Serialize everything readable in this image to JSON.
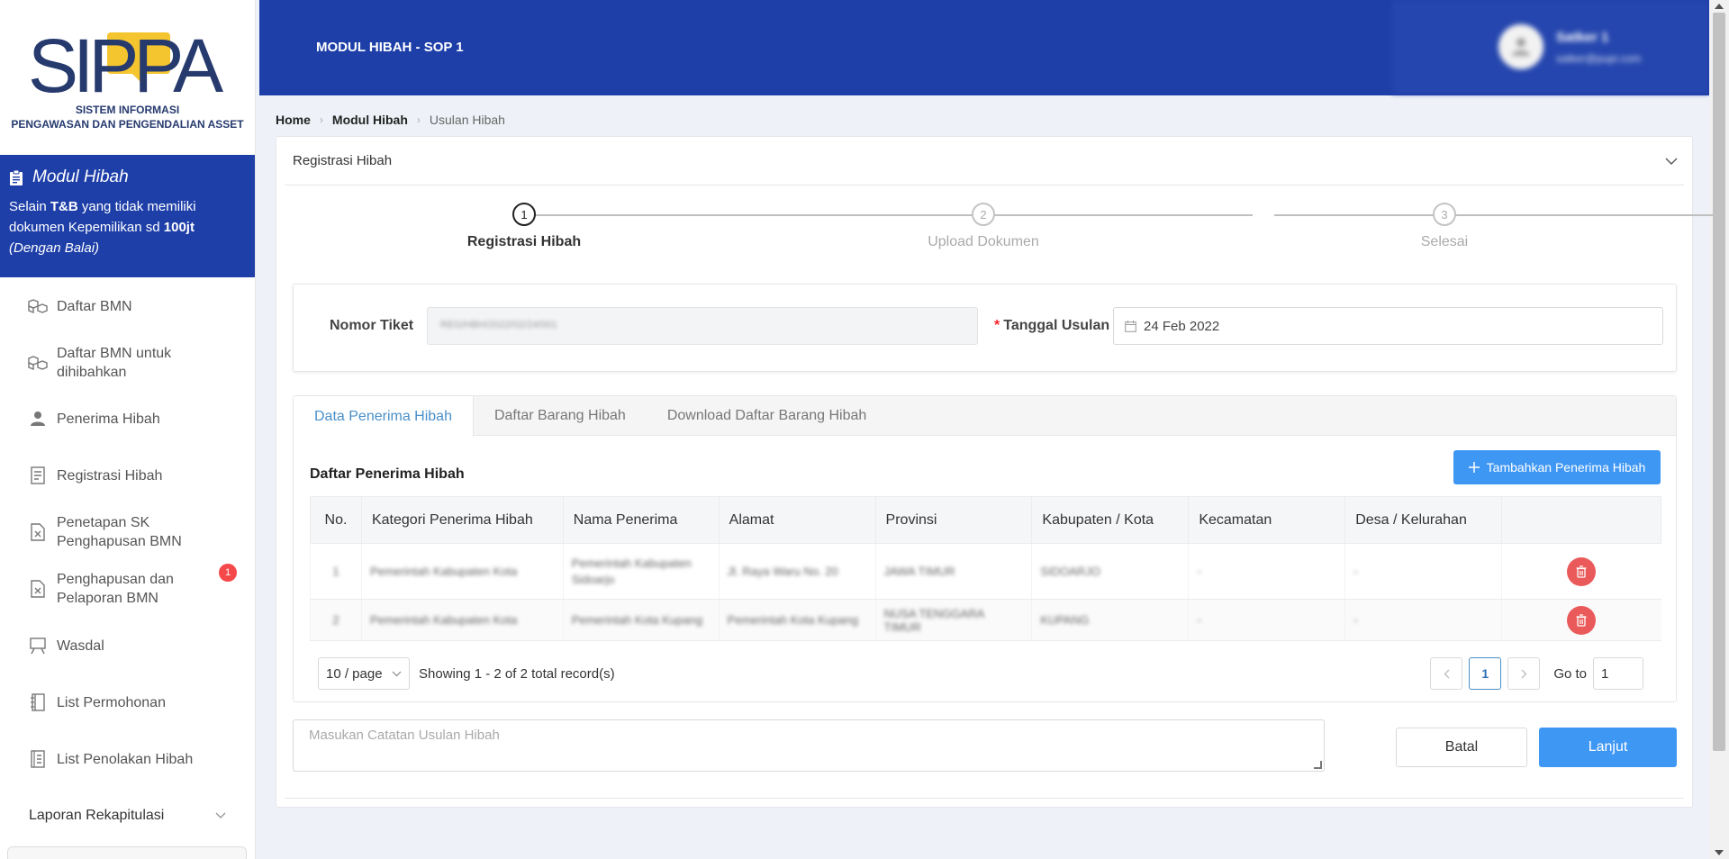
{
  "brand": {
    "logo_text": "SIPPA",
    "subtitle_line1": "SISTEM INFORMASI",
    "subtitle_line2": "PENGAWASAN DAN PENGENDALIAN ASSET",
    "colors": {
      "navy": "#263a6e",
      "gold": "#f4c52f"
    }
  },
  "module": {
    "title": "Modul Hibah",
    "desc_pre": "Selain ",
    "desc_bold1": "T&B",
    "desc_mid": " yang tidak memiliki dokumen Kepemilikan sd ",
    "desc_bold2": "100jt",
    "desc_italic": "(Dengan Balai)"
  },
  "sidebar": {
    "items": [
      {
        "label": "Daftar BMN",
        "icon": "boxes-icon"
      },
      {
        "label": "Daftar BMN untuk dihibahkan",
        "icon": "boxes-icon"
      },
      {
        "label": "Penerima Hibah",
        "icon": "user-icon"
      },
      {
        "label": "Registrasi Hibah",
        "icon": "document-icon"
      },
      {
        "label": "Penetapan SK Penghapusan BMN",
        "icon": "file-x-icon"
      },
      {
        "label": "Penghapusan dan Pelaporan BMN",
        "icon": "file-x-icon",
        "badge": "1"
      },
      {
        "label": "Wasdal",
        "icon": "board-icon"
      },
      {
        "label": "List Permohonan",
        "icon": "notebook-icon"
      },
      {
        "label": "List Penolakan Hibah",
        "icon": "list-icon"
      }
    ],
    "group_label": "Laporan Rekapitulasi"
  },
  "topbar": {
    "title": "MODUL HIBAH - SOP 1",
    "user_name": "Satker 1",
    "user_email": "satker@pupr.com"
  },
  "breadcrumb": [
    "Home",
    "Modul Hibah",
    "Usulan Hibah"
  ],
  "card": {
    "title": "Registrasi Hibah",
    "steps": [
      {
        "num": "1",
        "label": "Registrasi Hibah",
        "active": true
      },
      {
        "num": "2",
        "label": "Upload Dokumen",
        "active": false
      },
      {
        "num": "3",
        "label": "Selesai",
        "active": false
      }
    ],
    "ticket_label": "Nomor Tiket",
    "ticket_value": "REG/HBH/2022/02/24/001",
    "date_label": "Tanggal Usulan",
    "date_value": "24 Feb 2022"
  },
  "tabs": [
    "Data Penerima Hibah",
    "Daftar Barang Hibah",
    "Download Daftar Barang Hibah"
  ],
  "list": {
    "title": "Daftar Penerima Hibah",
    "add_button": "Tambahkan Penerima Hibah",
    "columns": [
      "No.",
      "Kategori Penerima Hibah",
      "Nama Penerima",
      "Alamat",
      "Provinsi",
      "Kabupaten / Kota",
      "Kecamatan",
      "Desa / Kelurahan",
      ""
    ],
    "rows": [
      [
        "1",
        "Pemerintah Kabupaten Kota",
        "Pemerintah Kabupaten Sidoarjo",
        "Jl. Raya Waru No. 20",
        "JAWA TIMUR",
        "SIDOARJO",
        "-",
        "-"
      ],
      [
        "2",
        "Pemerintah Kabupaten Kota",
        "Pemerintah Kota Kupang",
        "Pemerintah Kota Kupang",
        "NUSA TENGGARA TIMUR",
        "KUPANG",
        "-",
        "-"
      ]
    ],
    "page_size": "10 / page",
    "showing": "Showing 1 - 2 of 2 total record(s)",
    "current_page": "1",
    "goto_label": "Go to",
    "goto_value": "1"
  },
  "footer": {
    "note_placeholder": "Masukan Catatan Usulan Hibah",
    "cancel": "Batal",
    "next": "Lanjut"
  },
  "colors": {
    "primary": "#1e3fa8",
    "button": "#3f97f4",
    "danger": "#ea5a5a"
  }
}
